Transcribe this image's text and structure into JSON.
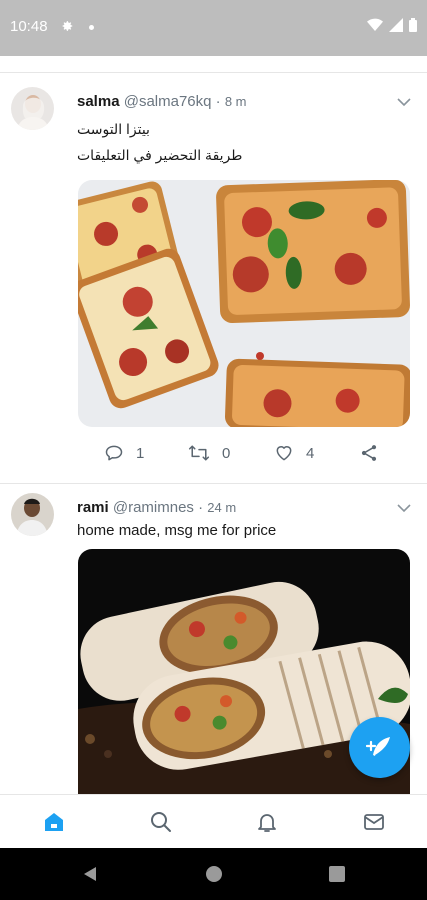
{
  "status": {
    "time": "10:48",
    "icons": [
      "gear-icon",
      "dot-icon",
      "wifi-icon",
      "signal-icon",
      "battery-icon"
    ]
  },
  "tweets": [
    {
      "name": "salma",
      "handle": "@salma76kq",
      "separator": "·",
      "time": "8 m",
      "text_lines": [
        "بيتزا التوست",
        "طريقة التحضير في التعليقات"
      ],
      "media": "pizza toast photo",
      "replies": "1",
      "retweets": "0",
      "likes": "4"
    },
    {
      "name": "rami",
      "handle": "@ramimnes",
      "separator": "·",
      "time": "24 m",
      "text_lines": [
        "home made, msg me for price"
      ],
      "media": "wrap sandwich photo"
    }
  ],
  "nav": {
    "items": [
      "home-icon",
      "search-icon",
      "notifications-icon",
      "messages-icon"
    ],
    "active": "home-icon"
  },
  "colors": {
    "accent": "#1da1f2",
    "status_bar": "#bdbdbd",
    "icon_gray": "#5b6670"
  }
}
